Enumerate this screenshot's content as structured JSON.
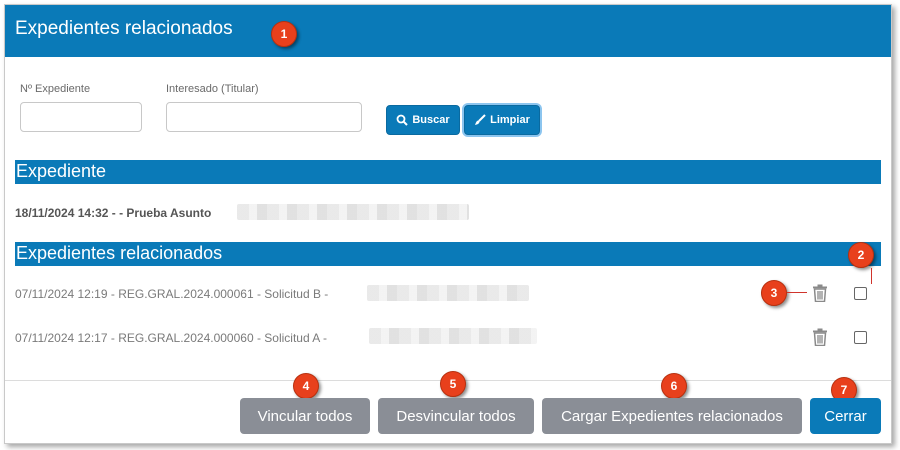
{
  "dialog": {
    "title": "Expedientes relacionados"
  },
  "search": {
    "expediente_label": "Nº Expediente",
    "expediente_value": "",
    "interesado_label": "Interesado (Titular)",
    "interesado_value": "",
    "buscar_label": "Buscar",
    "limpiar_label": "Limpiar"
  },
  "expediente_section": {
    "title": "Expediente",
    "item": "18/11/2024 14:32 - - Prueba Asunto"
  },
  "related_section": {
    "title": "Expedientes relacionados",
    "rows": [
      {
        "text": "07/11/2024 12:19 - REG.GRAL.2024.000061 - Solicitud B -"
      },
      {
        "text": "07/11/2024 12:17 - REG.GRAL.2024.000060 - Solicitud A -"
      }
    ]
  },
  "footer": {
    "vincular_label": "Vincular todos",
    "desvincular_label": "Desvincular todos",
    "cargar_label": "Cargar Expedientes relacionados",
    "cerrar_label": "Cerrar"
  },
  "markers": [
    "1",
    "2",
    "3",
    "4",
    "5",
    "6",
    "7"
  ],
  "icons": {
    "search": "search-icon",
    "brush": "brush-icon",
    "trash": "trash-icon",
    "checkbox": "checkbox"
  },
  "colors": {
    "primary": "#0a7ab8",
    "secondary_button": "#8a8e96",
    "marker": "#e8401c"
  }
}
